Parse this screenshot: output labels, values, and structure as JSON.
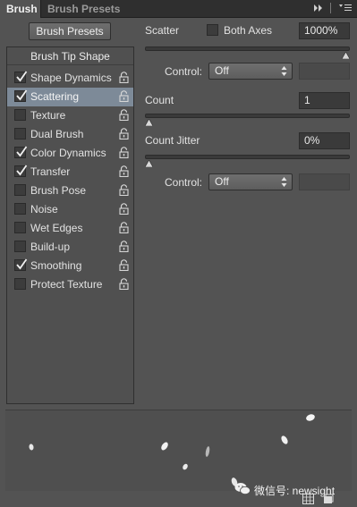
{
  "tabs": [
    {
      "label": "Brush",
      "active": true
    },
    {
      "label": "Brush Presets",
      "active": false
    }
  ],
  "left": {
    "presets_button": "Brush Presets",
    "tip_shape": "Brush Tip Shape",
    "options": [
      {
        "label": "Shape Dynamics",
        "checked": true,
        "selected": false
      },
      {
        "label": "Scattering",
        "checked": true,
        "selected": true
      },
      {
        "label": "Texture",
        "checked": false,
        "selected": false
      },
      {
        "label": "Dual Brush",
        "checked": false,
        "selected": false
      },
      {
        "label": "Color Dynamics",
        "checked": true,
        "selected": false
      },
      {
        "label": "Transfer",
        "checked": true,
        "selected": false
      },
      {
        "label": "Brush Pose",
        "checked": false,
        "selected": false
      },
      {
        "label": "Noise",
        "checked": false,
        "selected": false
      },
      {
        "label": "Wet Edges",
        "checked": false,
        "selected": false
      },
      {
        "label": "Build-up",
        "checked": false,
        "selected": false
      },
      {
        "label": "Smoothing",
        "checked": true,
        "selected": false
      },
      {
        "label": "Protect Texture",
        "checked": false,
        "selected": false
      }
    ]
  },
  "right": {
    "scatter_label": "Scatter",
    "both_axes_label": "Both Axes",
    "both_axes_checked": false,
    "scatter_value": "1000%",
    "scatter_level": 1.0,
    "control_label": "Control:",
    "control1_value": "Off",
    "count_label": "Count",
    "count_value": "1",
    "count_level": 0.0,
    "count_jitter_label": "Count Jitter",
    "count_jitter_value": "0%",
    "count_jitter_level": 0.0,
    "control2_value": "Off"
  },
  "watermark": "微信号: newsight",
  "colors": {
    "selected_row": "#7d8a98",
    "panel": "#535353"
  }
}
